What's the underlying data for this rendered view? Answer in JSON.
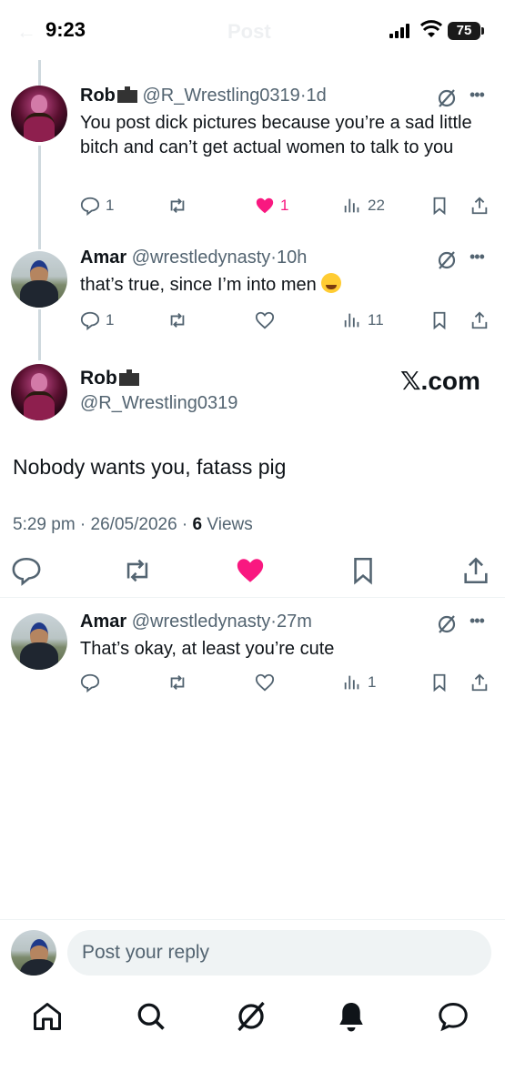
{
  "status_bar": {
    "time": "9:23",
    "battery": "75"
  },
  "header": {
    "title": "Post",
    "back_glyph": "←"
  },
  "replies_above": [
    {
      "name": "Rob",
      "handle": "@R_Wrestling0319",
      "time": "1d",
      "text": "You post dick pictures because you’re a sad little bitch and can’t get actual women to talk to you",
      "replies": "1",
      "likes": "1",
      "liked": true,
      "views": "22"
    },
    {
      "name": "Amar",
      "handle": "@wrestledynasty",
      "time": "10h",
      "text": "that’s true, since I’m into men",
      "replies": "1",
      "likes": "",
      "liked": false,
      "views": "11"
    }
  ],
  "main_post": {
    "name": "Rob",
    "handle": "@R_Wrestling0319",
    "watermark": "𝕏.com",
    "text": "Nobody wants you, fatass pig",
    "time": "5:29 pm",
    "date": "26/05/2026",
    "views_count": "6",
    "views_label": "Views"
  },
  "reply_below": {
    "name": "Amar",
    "handle": "@wrestledynasty",
    "time": "27m",
    "text": "That’s okay, at least you’re cute",
    "views": "1"
  },
  "composer": {
    "placeholder": "Post your reply"
  },
  "colors": {
    "accent_like": "#f91880",
    "muted": "#536471",
    "text": "#0f1419",
    "thread_line": "#cfd9de"
  },
  "icons": [
    "reply-icon",
    "repost-icon",
    "like-icon",
    "views-icon",
    "bookmark-icon",
    "share-icon",
    "grok-icon",
    "more-icon",
    "home-icon",
    "search-icon",
    "grok-nav-icon",
    "notifications-icon",
    "messages-icon"
  ]
}
